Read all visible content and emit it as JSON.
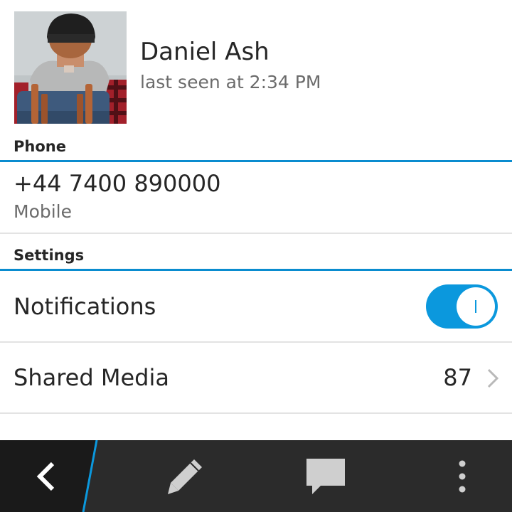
{
  "contact": {
    "name": "Daniel Ash",
    "last_seen": "last seen at 2:34 PM",
    "avatar_icon": "contact-photo"
  },
  "phone_section": {
    "header": "Phone",
    "number": "+44 7400 890000",
    "type": "Mobile"
  },
  "settings_section": {
    "header": "Settings",
    "notifications": {
      "label": "Notifications",
      "enabled": true
    },
    "shared_media": {
      "label": "Shared Media",
      "count": "87"
    }
  },
  "action_bar": {
    "items": [
      {
        "icon": "back-icon"
      },
      {
        "icon": "pencil-icon"
      },
      {
        "icon": "chat-bubble-icon"
      },
      {
        "icon": "overflow-menu-icon"
      }
    ]
  },
  "colors": {
    "accent": "#0a8ccf",
    "toggle_on": "#0b98dd",
    "action_bar_bg": "#2b2b2b",
    "divider": "#e3e3e3",
    "primary_text": "#262626",
    "secondary_text": "#6b6b6b"
  }
}
